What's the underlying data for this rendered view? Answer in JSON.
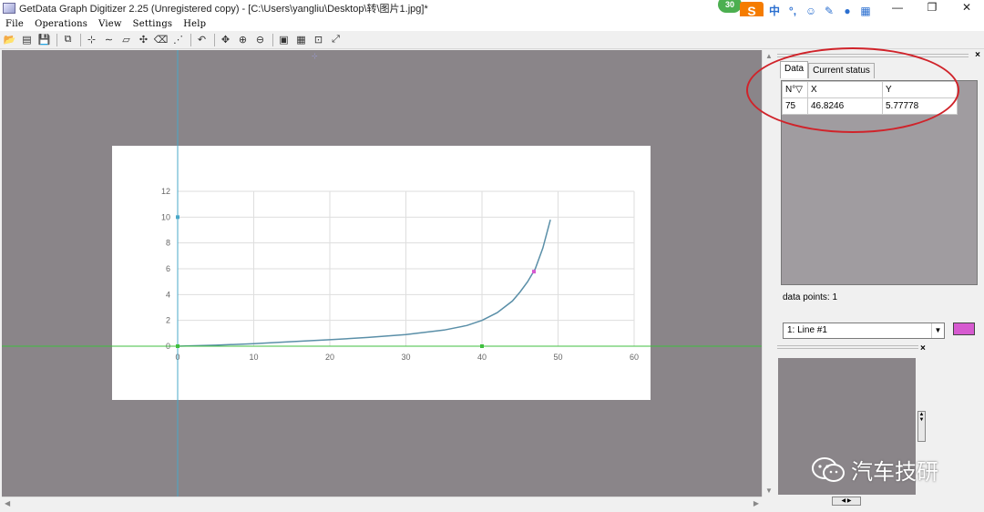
{
  "window": {
    "title": "GetData Graph Digitizer 2.25 (Unregistered copy) - [C:\\Users\\yangliu\\Desktop\\转\\图片1.jpg]*"
  },
  "ime": {
    "badge": "30",
    "logo": "S",
    "mode": "中",
    "punct": "°,"
  },
  "menu": [
    "File",
    "Operations",
    "View",
    "Settings",
    "Help"
  ],
  "toolbar_icons": [
    "open-icon",
    "scan-icon",
    "save-icon",
    "copy-icon",
    "point-mode-icon",
    "line-mode-icon",
    "area-icon",
    "move-icon",
    "eraser-icon",
    "digitize-icon",
    "undo-icon",
    "pan-icon",
    "zoom-in-icon",
    "zoom-out-icon",
    "image-icon",
    "grid-icon",
    "fit-icon",
    "fullscreen-icon"
  ],
  "panel": {
    "tabs": [
      "Data",
      "Current status"
    ],
    "active_tab": "Data",
    "table": {
      "headers": [
        "N°▽",
        "X",
        "Y"
      ],
      "rows": [
        [
          "75",
          "46.8246",
          "5.77778"
        ]
      ]
    },
    "data_points_label": "data points: 1",
    "line_select": "1: Line #1",
    "line_color": "#d65ad0"
  },
  "watermark": "汽车技研",
  "chart_data": {
    "type": "line",
    "x_ticks": [
      "0",
      "10",
      "20",
      "30",
      "40",
      "50",
      "60"
    ],
    "y_ticks": [
      "0",
      "2",
      "4",
      "6",
      "8",
      "10",
      "12"
    ],
    "xlim": [
      0,
      60
    ],
    "ylim": [
      0,
      12
    ],
    "grid": true,
    "series": [
      {
        "x": [
          0,
          5,
          10,
          15,
          20,
          25,
          30,
          35,
          38,
          40,
          42,
          44,
          45,
          46,
          47,
          48,
          49
        ],
        "y": [
          0,
          0.08,
          0.2,
          0.35,
          0.5,
          0.68,
          0.9,
          1.25,
          1.6,
          2.0,
          2.6,
          3.5,
          4.2,
          5.0,
          6.0,
          7.6,
          9.8
        ],
        "color": "#5a8fa8"
      }
    ],
    "digitized_point": {
      "x": 46.8246,
      "y": 5.77778
    },
    "calibration_points": [
      {
        "x": 0,
        "y": 10
      },
      {
        "x": 0,
        "y": 0
      },
      {
        "x": 40,
        "y": 0
      }
    ]
  }
}
